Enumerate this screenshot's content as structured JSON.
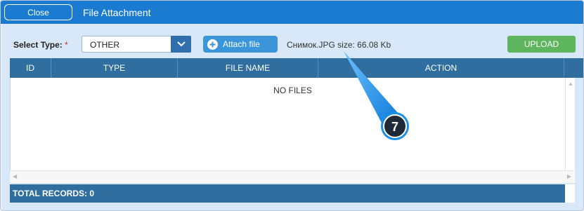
{
  "titlebar": {
    "close_label": "Close",
    "title": "File Attachment"
  },
  "form": {
    "select_type_label": "Select Type:",
    "required_mark": "*",
    "select_value": "OTHER",
    "attach_label": "Attach file",
    "file_info": "Снимок.JPG size: 66.08 Kb",
    "upload_label": "UPLOAD"
  },
  "grid": {
    "columns": [
      "ID",
      "TYPE",
      "FILE NAME",
      "ACTION"
    ],
    "empty_text": "NO FILES",
    "footer_text": "TOTAL RECORDS: 0"
  },
  "annotation": {
    "step_number": "7"
  },
  "colors": {
    "titlebar": "#1a7bd1",
    "grid_header": "#2f6e9e",
    "upload": "#5db65d",
    "callout": "#1a8fe8"
  },
  "icons": [
    "chevron-down-icon",
    "plus-circle-icon",
    "scroll-up-icon",
    "scroll-down-icon",
    "scroll-left-icon",
    "scroll-right-icon"
  ]
}
